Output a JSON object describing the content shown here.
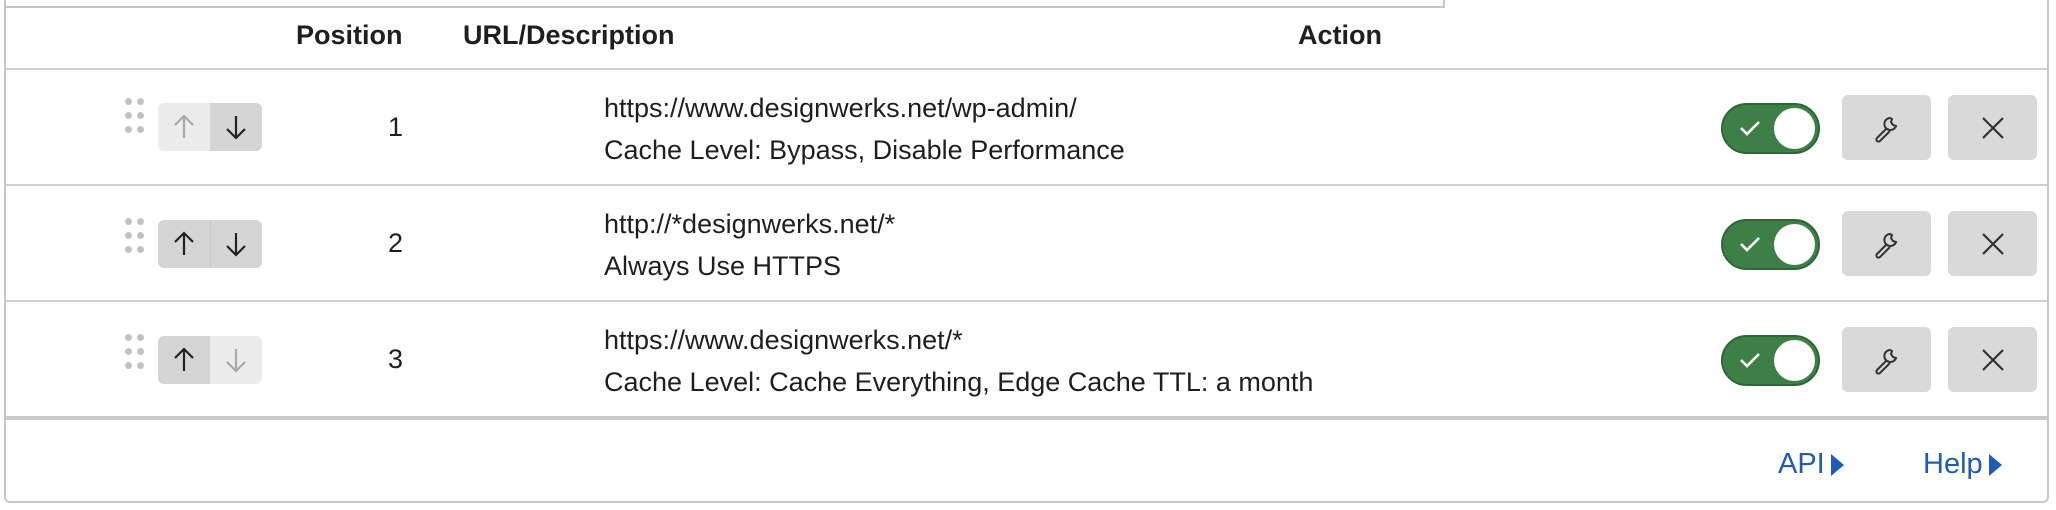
{
  "table": {
    "headers": {
      "position": "Position",
      "url": "URL/Description",
      "action": "Action"
    },
    "rows": [
      {
        "position": "1",
        "url": "https://www.designwerks.net/wp-admin/",
        "description": "Cache Level: Bypass, Disable Performance",
        "enabled": true,
        "move_up_enabled": false,
        "move_down_enabled": true
      },
      {
        "position": "2",
        "url": "http://*designwerks.net/*",
        "description": "Always Use HTTPS",
        "enabled": true,
        "move_up_enabled": true,
        "move_down_enabled": true
      },
      {
        "position": "3",
        "url": "https://www.designwerks.net/*",
        "description": "Cache Level: Cache Everything, Edge Cache TTL: a month",
        "enabled": true,
        "move_up_enabled": true,
        "move_down_enabled": false
      }
    ]
  },
  "footer": {
    "api_label": "API",
    "help_label": "Help"
  },
  "icons": {
    "drag": "drag-handle-icon",
    "up": "arrow-up-icon",
    "down": "arrow-down-icon",
    "check": "check-icon",
    "edit": "wrench-icon",
    "delete": "close-icon",
    "link": "triangle-right-icon"
  },
  "colors": {
    "toggle_on": "#3e7f46",
    "link": "#1f5bb9",
    "button_bg": "#d9d9d9"
  }
}
